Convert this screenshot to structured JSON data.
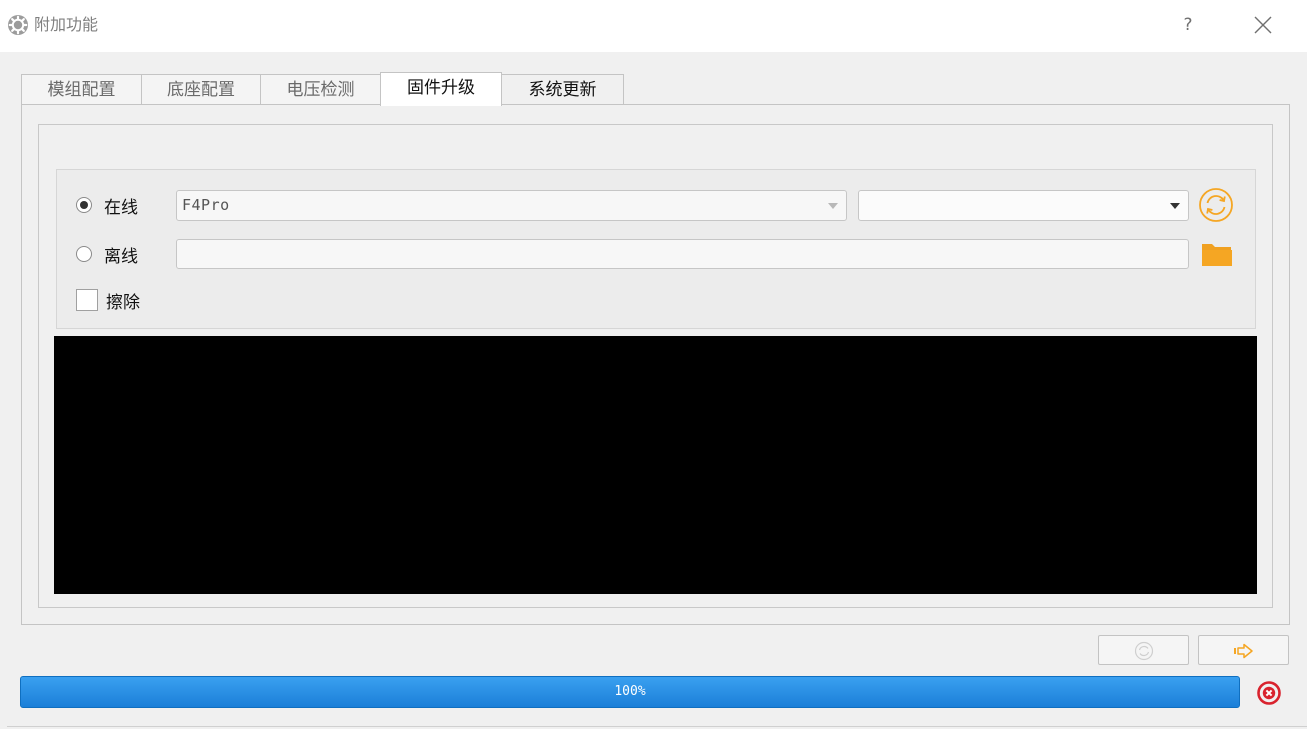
{
  "window": {
    "title": "附加功能",
    "help_label": "?",
    "title_icon": "gear-icon",
    "close_icon": "close-icon"
  },
  "tabs": [
    {
      "label": "模组配置",
      "active": false
    },
    {
      "label": "底座配置",
      "active": false
    },
    {
      "label": "电压检测",
      "active": false
    },
    {
      "label": "固件升级",
      "active": true
    },
    {
      "label": "系统更新",
      "active": false
    }
  ],
  "firmware": {
    "online": {
      "label": "在线",
      "checked": true,
      "model_value": "F4Pro",
      "version_value": ""
    },
    "offline": {
      "label": "离线",
      "checked": false,
      "path_value": ""
    },
    "erase": {
      "label": "擦除",
      "checked": false
    }
  },
  "progress": {
    "value": 100,
    "text": "100%"
  },
  "colors": {
    "accent": "#1a86e0",
    "icon_orange": "#f5a623",
    "cancel_red": "#d9232e",
    "console_bg": "#000000"
  }
}
